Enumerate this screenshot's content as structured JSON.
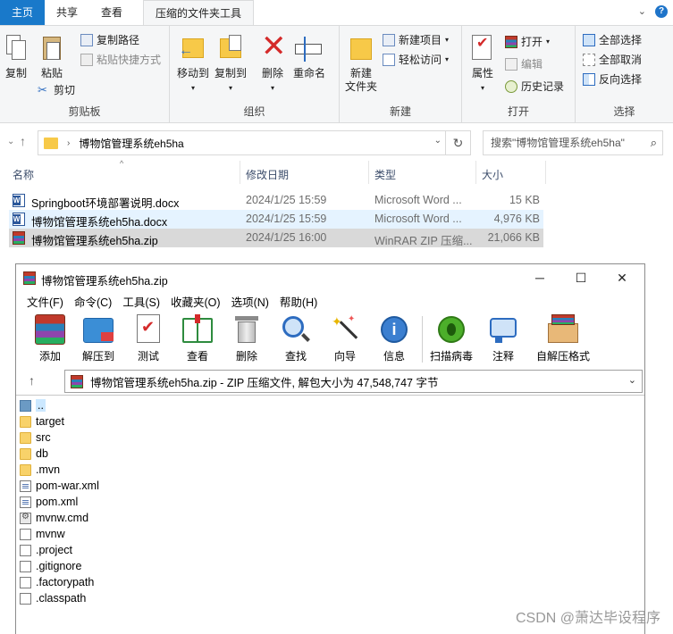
{
  "ribbon": {
    "tabs": [
      "主页",
      "共享",
      "查看"
    ],
    "context_tab": "压缩的文件夹工具",
    "groups": {
      "clipboard": {
        "label": "剪贴板",
        "copy": "复制",
        "paste": "粘贴",
        "copy_path": "复制路径",
        "paste_shortcut": "粘贴快捷方式",
        "cut": "剪切"
      },
      "organize": {
        "label": "组织",
        "move_to": "移动到",
        "copy_to": "复制到",
        "delete": "删除",
        "rename": "重命名"
      },
      "new": {
        "label": "新建",
        "new_folder": "新建\n文件夹",
        "new_item": "新建项目",
        "easy_access": "轻松访问"
      },
      "open": {
        "label": "打开",
        "properties": "属性",
        "open": "打开",
        "edit": "编辑",
        "history": "历史记录"
      },
      "select": {
        "label": "选择",
        "select_all": "全部选择",
        "select_none": "全部取消",
        "invert": "反向选择"
      }
    }
  },
  "address": {
    "path": "博物馆管理系统eh5ha",
    "search_placeholder": "搜索\"博物馆管理系统eh5ha\""
  },
  "file_list": {
    "columns": [
      "名称",
      "修改日期",
      "类型",
      "大小"
    ],
    "rows": [
      {
        "name": "Springboot环境部署说明.docx",
        "date": "2024/1/25 15:59",
        "type": "Microsoft Word ...",
        "size": "15 KB"
      },
      {
        "name": "博物馆管理系统eh5ha.docx",
        "date": "2024/1/25 15:59",
        "type": "Microsoft Word ...",
        "size": "4,976 KB"
      },
      {
        "name": "博物馆管理系统eh5ha.zip",
        "date": "2024/1/25 16:00",
        "type": "WinRAR ZIP 压缩...",
        "size": "21,066 KB"
      }
    ]
  },
  "winrar": {
    "title": "博物馆管理系统eh5ha.zip",
    "menu": [
      "文件(F)",
      "命令(C)",
      "工具(S)",
      "收藏夹(O)",
      "选项(N)",
      "帮助(H)"
    ],
    "toolbar": [
      "添加",
      "解压到",
      "测试",
      "查看",
      "删除",
      "查找",
      "向导",
      "信息",
      "扫描病毒",
      "注释",
      "自解压格式"
    ],
    "path_text": "博物馆管理系统eh5ha.zip - ZIP 压缩文件, 解包大小为 47,548,747 字节",
    "items": [
      "..",
      "target",
      "src",
      "db",
      ".mvn",
      "pom-war.xml",
      "pom.xml",
      "mvnw.cmd",
      "mvnw",
      ".project",
      ".gitignore",
      ".factorypath",
      ".classpath"
    ]
  },
  "watermark": "CSDN @萧达毕设程序"
}
